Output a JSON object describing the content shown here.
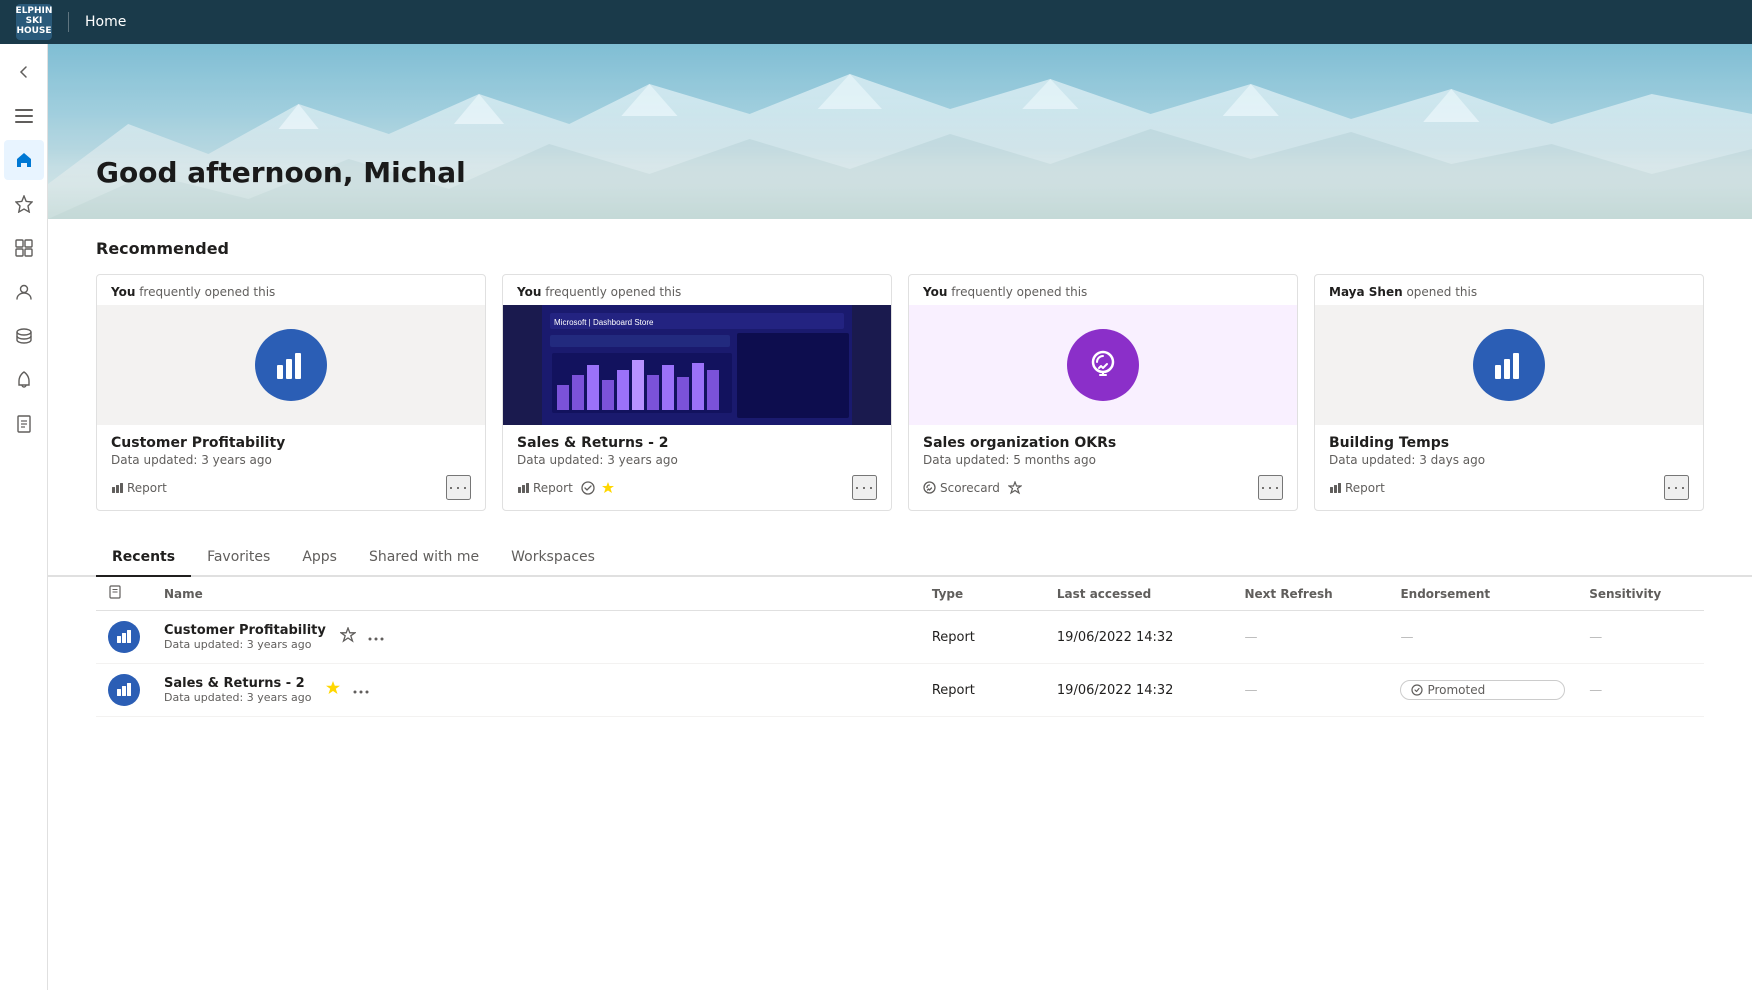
{
  "topbar": {
    "logo_line1": "ELPHIN",
    "logo_line2": "SKI HOUSE",
    "title": "Home"
  },
  "sidebar": {
    "items": [
      {
        "id": "back",
        "icon": "←",
        "label": "Back"
      },
      {
        "id": "menu",
        "icon": "≡",
        "label": "Menu"
      },
      {
        "id": "home",
        "icon": "⌂",
        "label": "Home",
        "active": true
      },
      {
        "id": "favorites",
        "icon": "☆",
        "label": "Favorites"
      },
      {
        "id": "browse",
        "icon": "⊞",
        "label": "Browse"
      },
      {
        "id": "people",
        "icon": "👤",
        "label": "People"
      },
      {
        "id": "data",
        "icon": "◫",
        "label": "Data"
      },
      {
        "id": "bell",
        "icon": "🔔",
        "label": "Notifications"
      },
      {
        "id": "reports",
        "icon": "📋",
        "label": "Reports"
      }
    ]
  },
  "hero": {
    "greeting": "Good afternoon, Michal"
  },
  "recommended": {
    "section_title": "Recommended",
    "cards": [
      {
        "id": "card1",
        "context": "You",
        "context_rest": " frequently opened this",
        "thumb_type": "icon",
        "icon_color": "bg-blue",
        "name": "Customer Profitability",
        "updated": "Data updated: 3 years ago",
        "type": "Report",
        "has_endorse": false,
        "has_star": false
      },
      {
        "id": "card2",
        "context": "You",
        "context_rest": " frequently opened this",
        "thumb_type": "screenshot",
        "name": "Sales & Returns  - 2",
        "updated": "Data updated: 3 years ago",
        "type": "Report",
        "has_endorse": true,
        "has_star": true
      },
      {
        "id": "card3",
        "context": "You",
        "context_rest": " frequently opened this",
        "thumb_type": "icon",
        "icon_color": "bg-purple",
        "icon": "🏆",
        "name": "Sales organization OKRs",
        "updated": "Data updated: 5 months ago",
        "type": "Scorecard",
        "has_endorse": false,
        "has_star": true
      },
      {
        "id": "card4",
        "context": "Maya Shen",
        "context_rest": " opened this",
        "thumb_type": "icon",
        "icon_color": "bg-darkblue",
        "name": "Building Temps",
        "updated": "Data updated: 3 days ago",
        "type": "Report",
        "has_endorse": false,
        "has_star": false
      }
    ]
  },
  "tabs": {
    "items": [
      {
        "id": "recents",
        "label": "Recents",
        "active": true
      },
      {
        "id": "favorites",
        "label": "Favorites"
      },
      {
        "id": "apps",
        "label": "Apps"
      },
      {
        "id": "shared",
        "label": "Shared with me"
      },
      {
        "id": "workspaces",
        "label": "Workspaces"
      }
    ]
  },
  "table": {
    "columns": [
      {
        "id": "icon",
        "label": ""
      },
      {
        "id": "name",
        "label": "Name"
      },
      {
        "id": "type",
        "label": "Type"
      },
      {
        "id": "last_accessed",
        "label": "Last accessed"
      },
      {
        "id": "next_refresh",
        "label": "Next Refresh"
      },
      {
        "id": "endorsement",
        "label": "Endorsement"
      },
      {
        "id": "sensitivity",
        "label": "Sensitivity"
      }
    ],
    "rows": [
      {
        "id": "row1",
        "name": "Customer Profitability",
        "updated": "Data updated: 3 years ago",
        "type": "Report",
        "last_accessed": "19/06/2022 14:32",
        "next_refresh": "—",
        "endorsement": "—",
        "sensitivity": "—",
        "is_starred": false,
        "promoted": false
      },
      {
        "id": "row2",
        "name": "Sales & Returns  - 2",
        "updated": "Data updated: 3 years ago",
        "type": "Report",
        "last_accessed": "19/06/2022 14:32",
        "next_refresh": "—",
        "endorsement": "Promoted",
        "sensitivity": "—",
        "is_starred": true,
        "promoted": true
      }
    ]
  }
}
